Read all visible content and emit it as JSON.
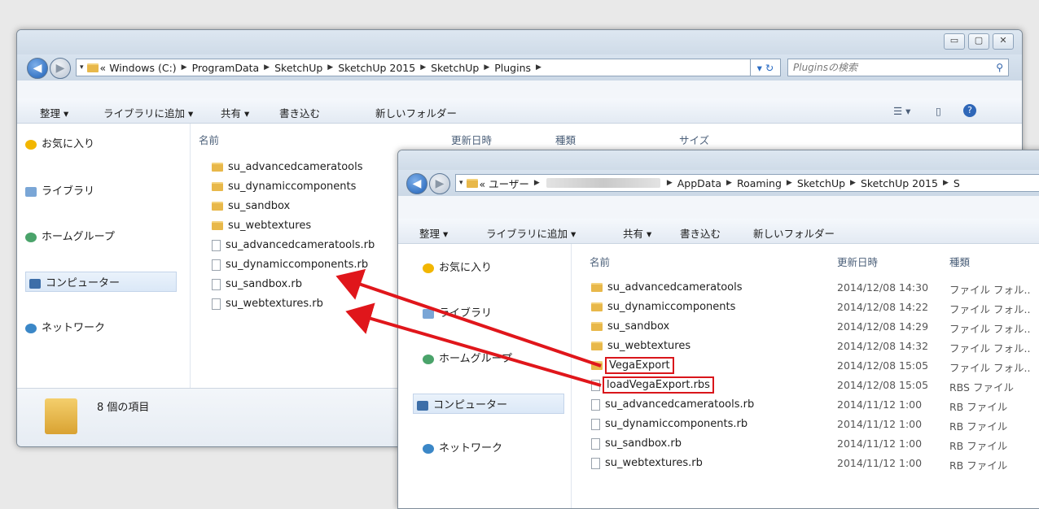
{
  "back_window": {
    "window_controls": [
      "▭",
      "▢",
      "✕"
    ],
    "breadcrumbs": [
      "Windows (C:)",
      "ProgramData",
      "SketchUp",
      "SketchUp 2015",
      "SketchUp",
      "Plugins"
    ],
    "breadcrumb_prefix": "«",
    "search_placeholder": "Pluginsの検索",
    "toolbar": {
      "organize": "整理 ▾",
      "add_library": "ライブラリに追加 ▾",
      "share": "共有 ▾",
      "burn": "書き込む",
      "new_folder": "新しいフォルダー"
    },
    "nav": {
      "favorites": "お気に入り",
      "libraries": "ライブラリ",
      "homegroup": "ホームグループ",
      "computer": "コンピューター",
      "network": "ネットワーク"
    },
    "columns": {
      "name": "名前",
      "date": "更新日時",
      "type": "種類",
      "size": "サイズ"
    },
    "files": [
      {
        "name": "su_advancedcameratools",
        "kind": "folder"
      },
      {
        "name": "su_dynamiccomponents",
        "kind": "folder"
      },
      {
        "name": "su_sandbox",
        "kind": "folder"
      },
      {
        "name": "su_webtextures",
        "kind": "folder"
      },
      {
        "name": "su_advancedcameratools.rb",
        "kind": "file"
      },
      {
        "name": "su_dynamiccomponents.rb",
        "kind": "file"
      },
      {
        "name": "su_sandbox.rb",
        "kind": "file"
      },
      {
        "name": "su_webtextures.rb",
        "kind": "file"
      }
    ],
    "status": "8 個の項目"
  },
  "front_window": {
    "breadcrumb_prefix": "« ユーザー",
    "breadcrumbs": [
      "AppData",
      "Roaming",
      "SketchUp",
      "SketchUp 2015",
      "S"
    ],
    "toolbar": {
      "organize": "整理 ▾",
      "add_library": "ライブラリに追加 ▾",
      "share": "共有 ▾",
      "burn": "書き込む",
      "new_folder": "新しいフォルダー"
    },
    "nav": {
      "favorites": "お気に入り",
      "libraries": "ライブラリ",
      "homegroup": "ホームグループ",
      "computer": "コンピューター",
      "network": "ネットワーク"
    },
    "columns": {
      "name": "名前",
      "date": "更新日時",
      "type": "種類"
    },
    "files": [
      {
        "name": "su_advancedcameratools",
        "date": "2014/12/08 14:30",
        "type": "ファイル フォル..",
        "kind": "folder"
      },
      {
        "name": "su_dynamiccomponents",
        "date": "2014/12/08 14:22",
        "type": "ファイル フォル..",
        "kind": "folder"
      },
      {
        "name": "su_sandbox",
        "date": "2014/12/08 14:29",
        "type": "ファイル フォル..",
        "kind": "folder"
      },
      {
        "name": "su_webtextures",
        "date": "2014/12/08 14:32",
        "type": "ファイル フォル..",
        "kind": "folder"
      },
      {
        "name": "VegaExport",
        "date": "2014/12/08 15:05",
        "type": "ファイル フォル..",
        "kind": "folder",
        "highlight": true
      },
      {
        "name": "loadVegaExport.rbs",
        "date": "2014/12/08 15:05",
        "type": "RBS ファイル",
        "kind": "file",
        "highlight": true
      },
      {
        "name": "su_advancedcameratools.rb",
        "date": "2014/11/12 1:00",
        "type": "RB ファイル",
        "kind": "file"
      },
      {
        "name": "su_dynamiccomponents.rb",
        "date": "2014/11/12 1:00",
        "type": "RB ファイル",
        "kind": "file"
      },
      {
        "name": "su_sandbox.rb",
        "date": "2014/11/12 1:00",
        "type": "RB ファイル",
        "kind": "file"
      },
      {
        "name": "su_webtextures.rb",
        "date": "2014/11/12 1:00",
        "type": "RB ファイル",
        "kind": "file"
      }
    ]
  },
  "colors": {
    "highlight": "#d9161b",
    "arrow": "#e0161b"
  }
}
